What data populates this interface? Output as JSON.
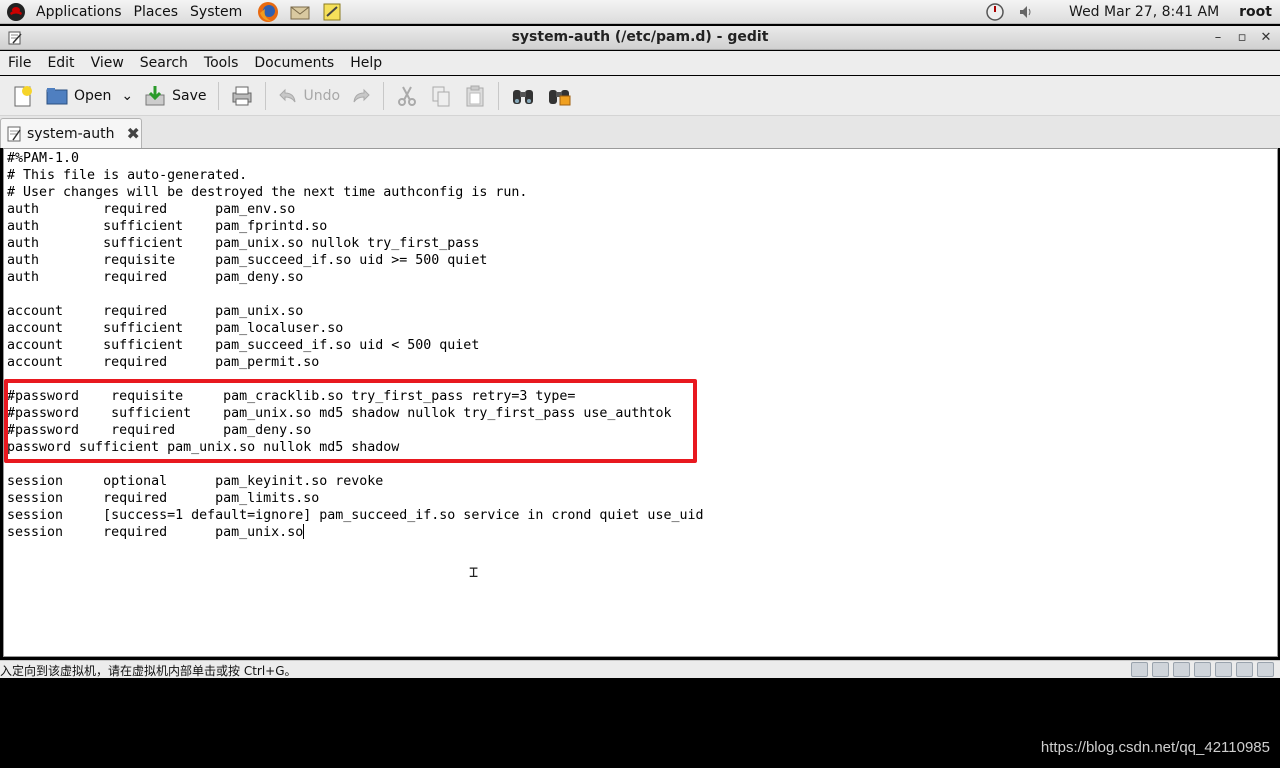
{
  "panel": {
    "menus": [
      "Applications",
      "Places",
      "System"
    ],
    "clock": "Wed Mar 27,  8:41 AM",
    "user": "root"
  },
  "window": {
    "title": "system-auth (/etc/pam.d) - gedit",
    "minimize": "–",
    "maximize": "▫",
    "close": "✕"
  },
  "menubar": [
    "File",
    "Edit",
    "View",
    "Search",
    "Tools",
    "Documents",
    "Help"
  ],
  "toolbar": {
    "open_label": "Open",
    "save_label": "Save",
    "undo_label": "Undo"
  },
  "tab": {
    "label": "system-auth",
    "close": "✖"
  },
  "editor": {
    "lines": [
      "#%PAM-1.0",
      "# This file is auto-generated.",
      "# User changes will be destroyed the next time authconfig is run.",
      "auth        required      pam_env.so",
      "auth        sufficient    pam_fprintd.so",
      "auth        sufficient    pam_unix.so nullok try_first_pass",
      "auth        requisite     pam_succeed_if.so uid >= 500 quiet",
      "auth        required      pam_deny.so",
      "",
      "account     required      pam_unix.so",
      "account     sufficient    pam_localuser.so",
      "account     sufficient    pam_succeed_if.so uid < 500 quiet",
      "account     required      pam_permit.so",
      "",
      "#password    requisite     pam_cracklib.so try_first_pass retry=3 type=",
      "#password    sufficient    pam_unix.so md5 shadow nullok try_first_pass use_authtok",
      "#password    required      pam_deny.so",
      "password sufficient pam_unix.so nullok md5 shadow",
      "",
      "session     optional      pam_keyinit.so revoke",
      "session     required      pam_limits.so",
      "session     [success=1 default=ignore] pam_succeed_if.so service in crond quiet use_uid",
      "session     required      pam_unix.so"
    ]
  },
  "statusbar": {
    "message": "入定向到该虚拟机，请在虚拟机内部单击或按 Ctrl+G。"
  },
  "watermark": "https://blog.csdn.net/qq_42110985",
  "colors": {
    "highlight_box": "#e8181f"
  }
}
